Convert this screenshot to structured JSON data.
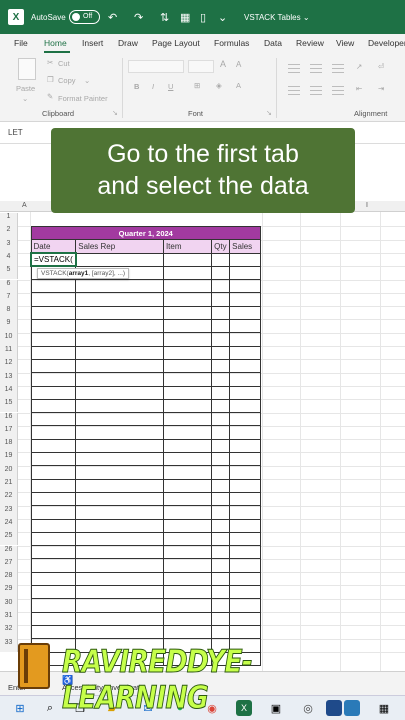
{
  "titlebar": {
    "autosave_label": "AutoSave",
    "autosave_state": "Off",
    "document_title": "VSTACK Tables ⌄"
  },
  "tabs": [
    "File",
    "Home",
    "Insert",
    "Draw",
    "Page Layout",
    "Formulas",
    "Data",
    "Review",
    "View",
    "Developer"
  ],
  "active_tab": "Home",
  "ribbon": {
    "paste": "Paste",
    "cut": "Cut",
    "copy": "Copy",
    "format_painter": "Format Painter",
    "clipboard_label": "Clipboard",
    "font_label": "Font",
    "alignment_label": "Alignment"
  },
  "formula_bar": {
    "name_box": "LET"
  },
  "banner": {
    "line1": "Go to the first tab",
    "line2": "and select the data"
  },
  "sheet": {
    "columns": [
      "A",
      "I"
    ],
    "rows": [
      "1",
      "2",
      "3",
      "4",
      "5",
      "6",
      "7",
      "8",
      "9",
      "10",
      "11",
      "12",
      "13",
      "14",
      "15",
      "16",
      "17",
      "18",
      "19",
      "20",
      "21",
      "22",
      "23",
      "24",
      "25",
      "26",
      "27",
      "28",
      "29",
      "30",
      "31",
      "32",
      "33"
    ],
    "table_title": "Quarter 1, 2024",
    "headers": [
      "Date",
      "Sales Rep",
      "Item",
      "Qty",
      "Sales"
    ],
    "active_cell_text": "=VSTACK(",
    "tooltip_bold": "array1",
    "tooltip_prefix": "VSTACK(",
    "tooltip_rest": ", [array2], ...)"
  },
  "status": {
    "mode": "Enter",
    "accessibility": "Accessibility: Investigate"
  },
  "watermark": "RAVIREDDYE-LEARNING",
  "colors": {
    "excel_green": "#1e7145",
    "table_header": "#a23aa0",
    "column_header": "#f1d4f1",
    "banner": "#4f7434"
  }
}
